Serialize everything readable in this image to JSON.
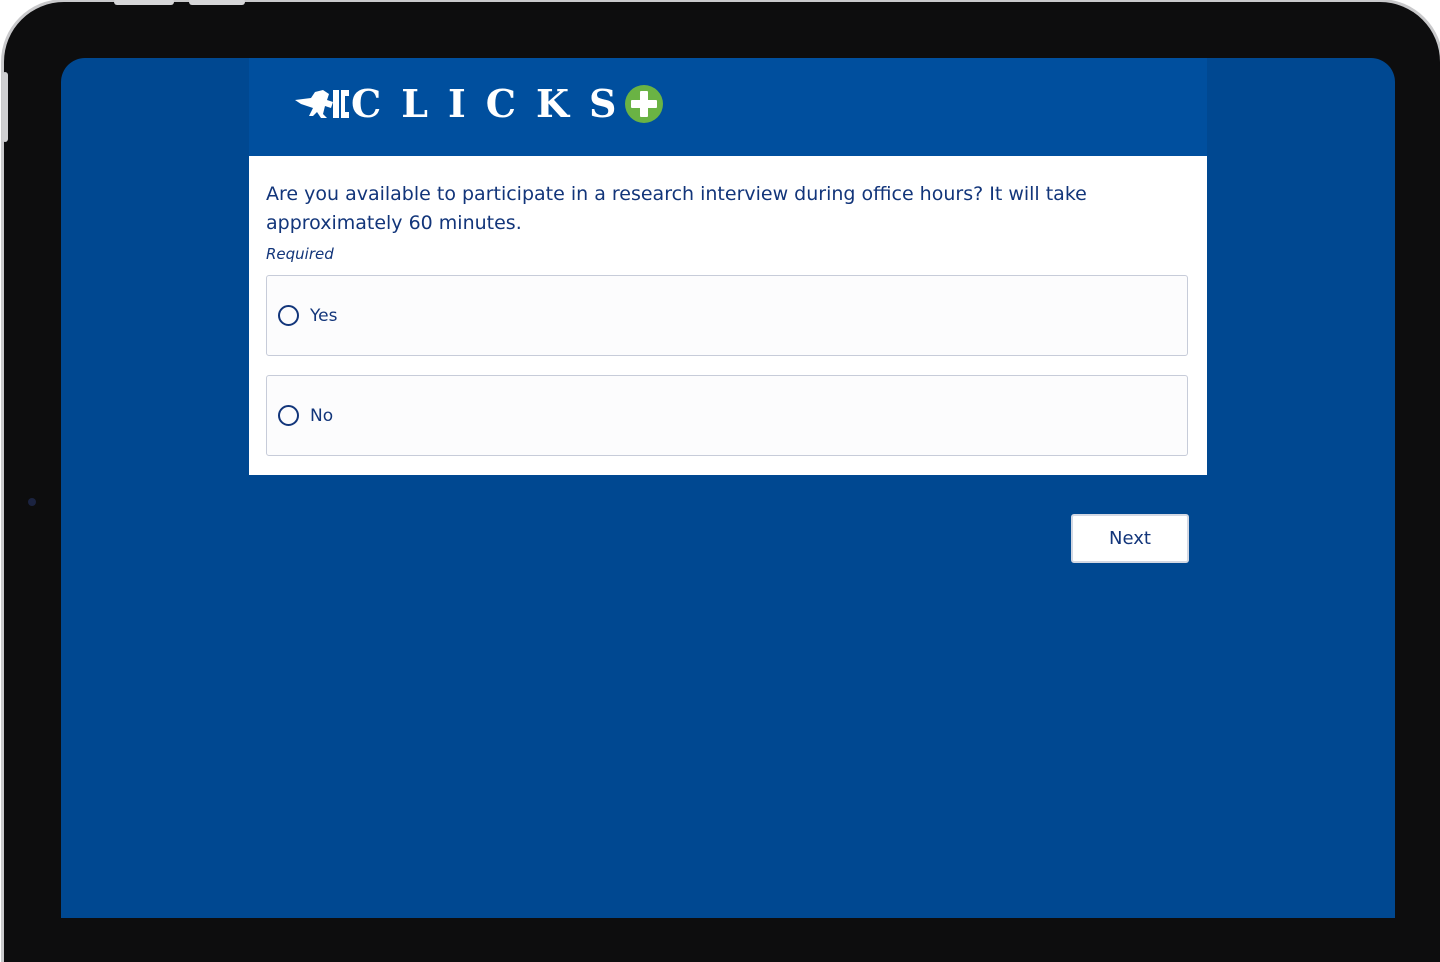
{
  "header": {
    "logo_text": "CLICKS",
    "logo_icon": "unicorn-icon",
    "logo_plus_icon": "green-plus-icon"
  },
  "form": {
    "question": "Are you available to participate in a research interview during office hours? It will take approximately 60 minutes.",
    "required_label": "Required",
    "options": [
      {
        "label": "Yes",
        "selected": false
      },
      {
        "label": "No",
        "selected": false
      }
    ],
    "next_label": "Next"
  },
  "colors": {
    "background": "#004891",
    "header": "#004f9e",
    "text": "#12357a",
    "plus": "#6ab344"
  }
}
